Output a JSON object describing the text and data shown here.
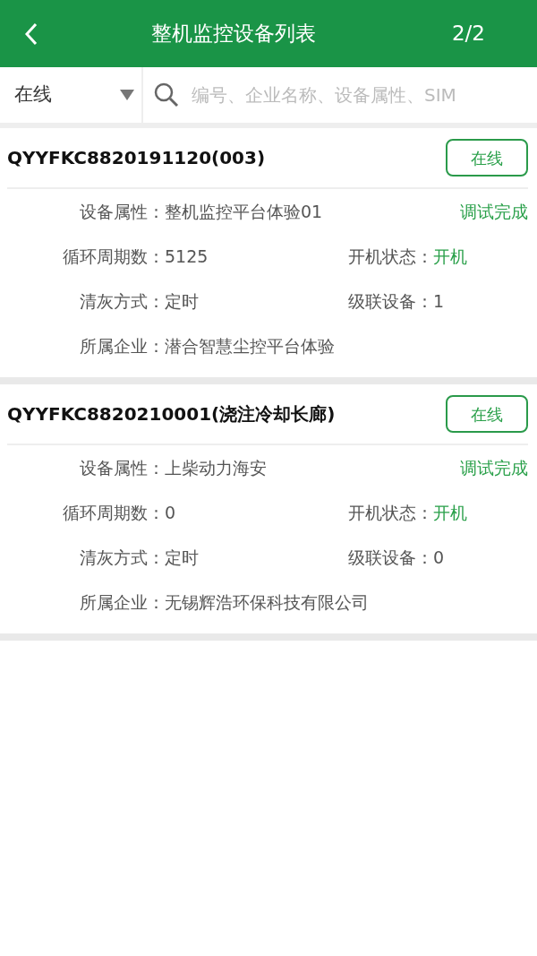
{
  "header": {
    "title": "整机监控设备列表",
    "page": "2/2"
  },
  "filter": {
    "value": "在线"
  },
  "search": {
    "placeholder": "编号、企业名称、设备属性、SIM"
  },
  "devices": [
    {
      "name": "QYYFKC8820191120(003)",
      "status": "在线",
      "attribute": {
        "label": "设备属性：",
        "value": "整机监控平台体验01"
      },
      "debug_status": "调试完成",
      "rows": [
        {
          "cells": [
            {
              "label": "循环周期数：",
              "value": "5125",
              "highlight": false
            },
            {
              "label": "开机状态：",
              "value": "开机",
              "highlight": true
            }
          ]
        },
        {
          "cells": [
            {
              "label": "清灰方式：",
              "value": "定时",
              "highlight": false
            },
            {
              "label": "级联设备：",
              "value": "1",
              "highlight": false
            }
          ]
        },
        {
          "cells": [
            {
              "label": "所属企业：",
              "value": "潜合智慧尘控平台体验",
              "highlight": false
            }
          ]
        }
      ]
    },
    {
      "name": "QYYFKC8820210001(浇注冷却长廊)",
      "status": "在线",
      "attribute": {
        "label": "设备属性：",
        "value": "上柴动力海安"
      },
      "debug_status": "调试完成",
      "rows": [
        {
          "cells": [
            {
              "label": "循环周期数：",
              "value": "0",
              "highlight": false
            },
            {
              "label": "开机状态：",
              "value": "开机",
              "highlight": true
            }
          ]
        },
        {
          "cells": [
            {
              "label": "清灰方式：",
              "value": "定时",
              "highlight": false
            },
            {
              "label": "级联设备：",
              "value": "0",
              "highlight": false
            }
          ]
        },
        {
          "cells": [
            {
              "label": "所属企业：",
              "value": "无锡辉浩环保科技有限公司",
              "highlight": false
            }
          ]
        }
      ]
    }
  ]
}
